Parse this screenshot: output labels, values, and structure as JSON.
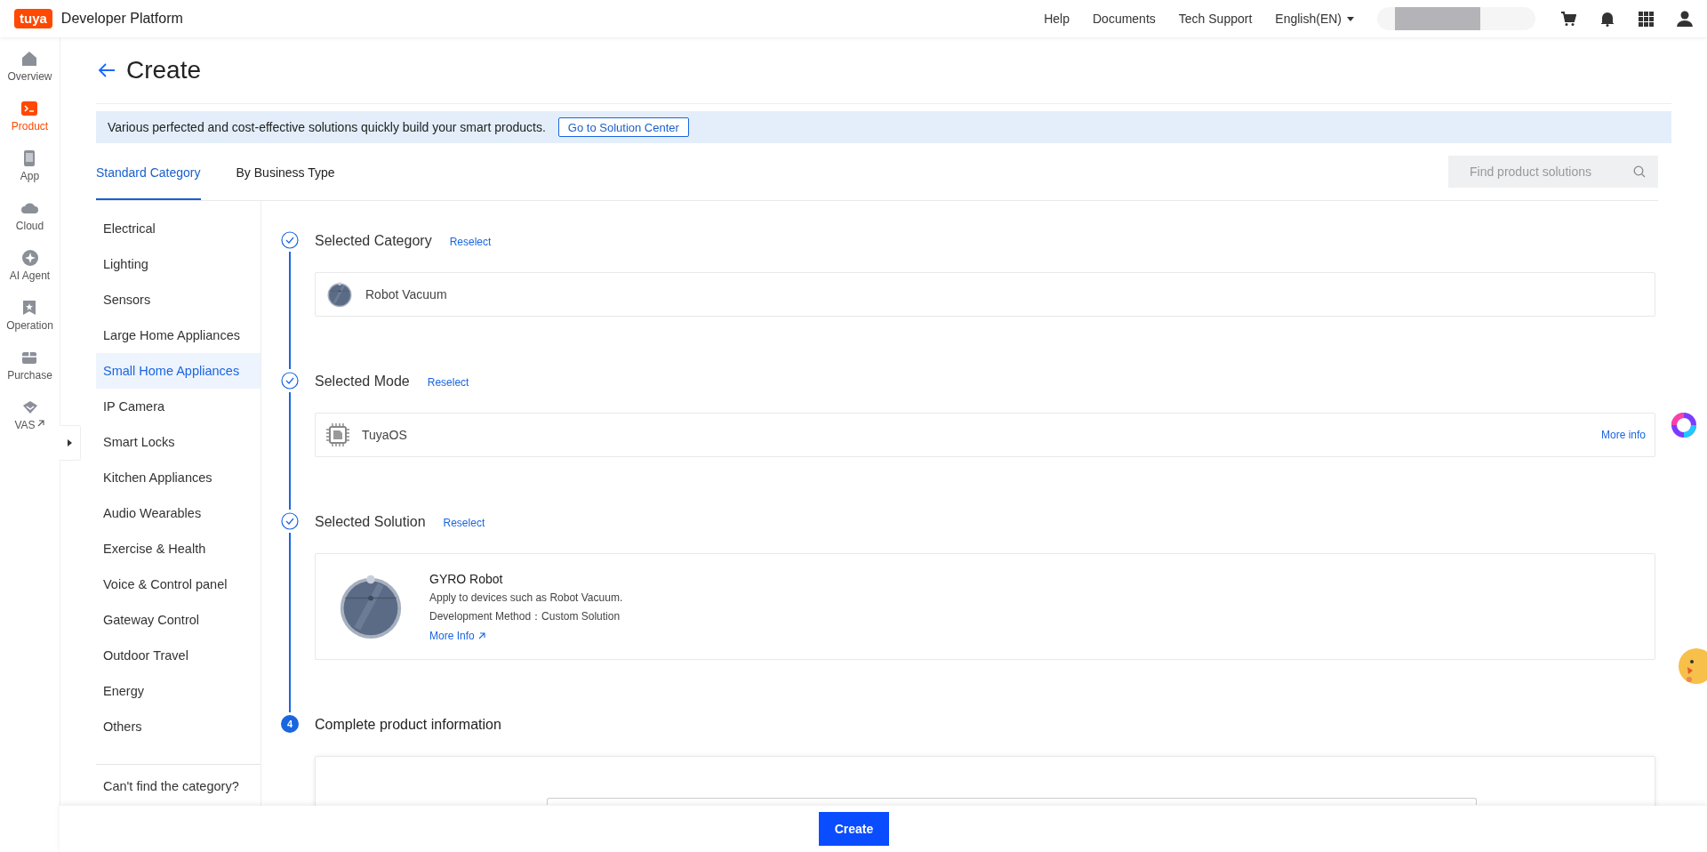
{
  "header": {
    "logo": "tuya",
    "title": "Developer Platform",
    "nav": [
      "Help",
      "Documents",
      "Tech Support"
    ],
    "language": "English(EN)"
  },
  "rail": [
    {
      "label": "Overview",
      "selected": false,
      "external": false
    },
    {
      "label": "Product",
      "selected": true,
      "external": false
    },
    {
      "label": "App",
      "selected": false,
      "external": false
    },
    {
      "label": "Cloud",
      "selected": false,
      "external": false
    },
    {
      "label": "AI Agent",
      "selected": false,
      "external": false
    },
    {
      "label": "Operation",
      "selected": false,
      "external": false
    },
    {
      "label": "Purchase",
      "selected": false,
      "external": false
    },
    {
      "label": "VAS",
      "selected": false,
      "external": true
    }
  ],
  "page": {
    "title": "Create"
  },
  "banner": {
    "text": "Various perfected and cost-effective solutions quickly build your smart products.",
    "button": "Go to Solution Center"
  },
  "tabs": [
    {
      "label": "Standard Category",
      "selected": true
    },
    {
      "label": "By Business Type",
      "selected": false
    }
  ],
  "search": {
    "placeholder": "Find product solutions"
  },
  "categories": [
    {
      "label": "Electrical",
      "selected": false
    },
    {
      "label": "Lighting",
      "selected": false
    },
    {
      "label": "Sensors",
      "selected": false
    },
    {
      "label": "Large Home Appliances",
      "selected": false
    },
    {
      "label": "Small Home Appliances",
      "selected": true
    },
    {
      "label": "IP Camera",
      "selected": false
    },
    {
      "label": "Smart Locks",
      "selected": false
    },
    {
      "label": "Kitchen Appliances",
      "selected": false
    },
    {
      "label": "Audio Wearables",
      "selected": false
    },
    {
      "label": "Exercise & Health",
      "selected": false
    },
    {
      "label": "Voice & Control panel",
      "selected": false
    },
    {
      "label": "Gateway Control",
      "selected": false
    },
    {
      "label": "Outdoor Travel",
      "selected": false
    },
    {
      "label": "Energy",
      "selected": false
    },
    {
      "label": "Others",
      "selected": false
    }
  ],
  "category_help": "Can't find the category?",
  "steps": [
    {
      "kind": "category",
      "done": true,
      "title": "Selected Category",
      "action": "Reselect",
      "item": {
        "name": "Robot Vacuum"
      }
    },
    {
      "kind": "mode",
      "done": true,
      "title": "Selected Mode",
      "action": "Reselect",
      "item": {
        "name": "TuyaOS",
        "link": "More info"
      }
    },
    {
      "kind": "solution",
      "done": true,
      "title": "Selected Solution",
      "action": "Reselect",
      "item": {
        "name": "GYRO Robot",
        "description": "Apply to devices such as Robot Vacuum.",
        "method": "Development Method：Custom Solution",
        "link": "More Info"
      }
    },
    {
      "kind": "form",
      "done": false,
      "number": "4",
      "title": "Complete product information"
    }
  ],
  "footer": {
    "button": "Create"
  }
}
